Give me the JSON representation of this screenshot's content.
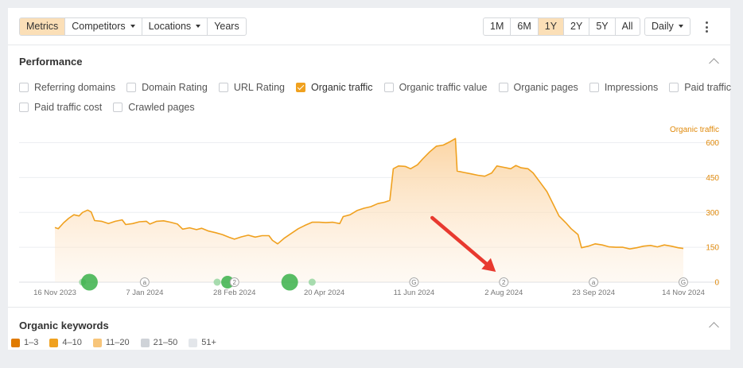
{
  "toolbar": {
    "left_tabs": [
      {
        "label": "Metrics",
        "active": true,
        "dropdown": false
      },
      {
        "label": "Competitors",
        "active": false,
        "dropdown": true
      },
      {
        "label": "Locations",
        "active": false,
        "dropdown": true
      },
      {
        "label": "Years",
        "active": false,
        "dropdown": false
      }
    ],
    "ranges": [
      {
        "label": "1M",
        "active": false
      },
      {
        "label": "6M",
        "active": false
      },
      {
        "label": "1Y",
        "active": true
      },
      {
        "label": "2Y",
        "active": false
      },
      {
        "label": "5Y",
        "active": false
      },
      {
        "label": "All",
        "active": false
      }
    ],
    "interval": "Daily"
  },
  "performance": {
    "title": "Performance",
    "metrics_row1": [
      {
        "label": "Referring domains",
        "checked": false
      },
      {
        "label": "Domain Rating",
        "checked": false
      },
      {
        "label": "URL Rating",
        "checked": false
      },
      {
        "label": "Organic traffic",
        "checked": true
      },
      {
        "label": "Organic traffic value",
        "checked": false
      },
      {
        "label": "Organic pages",
        "checked": false
      },
      {
        "label": "Impressions",
        "checked": false
      },
      {
        "label": "Paid traffic",
        "checked": false
      }
    ],
    "metrics_row2": [
      {
        "label": "Paid traffic cost",
        "checked": false
      },
      {
        "label": "Crawled pages",
        "checked": false
      }
    ]
  },
  "organic_keywords": {
    "title": "Organic keywords",
    "legend": [
      {
        "label": "1–3",
        "color": "#e07b00"
      },
      {
        "label": "4–10",
        "color": "#f0a11f"
      },
      {
        "label": "11–20",
        "color": "#f7c57a"
      },
      {
        "label": "21–50",
        "color": "#cfd3d8"
      },
      {
        "label": "51+",
        "color": "#e3e6ea"
      }
    ]
  },
  "colors": {
    "accent": "#f0a11f",
    "line": "#f0a11f",
    "area_top": "#fbd9ad",
    "marker_green": "#3bb24a",
    "arrow": "#e8392f"
  },
  "chart_data": {
    "type": "area",
    "series_label": "Organic traffic",
    "ylim": [
      0,
      660
    ],
    "y_ticks": [
      "600",
      "450",
      "300",
      "150",
      "0"
    ],
    "y_tick_values": [
      600,
      450,
      300,
      150,
      0
    ],
    "x_ticks": [
      "16 Nov 2023",
      "7 Jan 2024",
      "28 Feb 2024",
      "20 Apr 2024",
      "11 Jun 2024",
      "2 Aug 2024",
      "23 Sep 2024",
      "14 Nov 2024"
    ],
    "x_tick_dates": [
      "2023-11-16",
      "2024-01-07",
      "2024-02-28",
      "2024-04-20",
      "2024-06-11",
      "2024-08-02",
      "2024-09-23",
      "2024-11-14"
    ],
    "series": [
      {
        "name": "Organic traffic",
        "points": [
          [
            "2023-11-16",
            235
          ],
          [
            "2023-11-18",
            230
          ],
          [
            "2023-11-21",
            255
          ],
          [
            "2023-11-24",
            275
          ],
          [
            "2023-11-27",
            290
          ],
          [
            "2023-11-30",
            285
          ],
          [
            "2023-12-02",
            300
          ],
          [
            "2023-12-05",
            310
          ],
          [
            "2023-12-07",
            302
          ],
          [
            "2023-12-09",
            265
          ],
          [
            "2023-12-13",
            262
          ],
          [
            "2023-12-17",
            252
          ],
          [
            "2023-12-21",
            262
          ],
          [
            "2023-12-25",
            268
          ],
          [
            "2023-12-27",
            248
          ],
          [
            "2023-12-31",
            252
          ],
          [
            "2024-01-04",
            260
          ],
          [
            "2024-01-08",
            262
          ],
          [
            "2024-01-10",
            250
          ],
          [
            "2024-01-14",
            262
          ],
          [
            "2024-01-18",
            264
          ],
          [
            "2024-01-22",
            258
          ],
          [
            "2024-01-26",
            250
          ],
          [
            "2024-01-29",
            228
          ],
          [
            "2024-02-02",
            234
          ],
          [
            "2024-02-06",
            226
          ],
          [
            "2024-02-09",
            232
          ],
          [
            "2024-02-13",
            220
          ],
          [
            "2024-02-17",
            213
          ],
          [
            "2024-02-21",
            205
          ],
          [
            "2024-02-25",
            193
          ],
          [
            "2024-02-28",
            185
          ],
          [
            "2024-03-03",
            195
          ],
          [
            "2024-03-07",
            202
          ],
          [
            "2024-03-11",
            194
          ],
          [
            "2024-03-15",
            200
          ],
          [
            "2024-03-19",
            200
          ],
          [
            "2024-03-21",
            180
          ],
          [
            "2024-03-24",
            165
          ],
          [
            "2024-03-28",
            190
          ],
          [
            "2024-04-01",
            210
          ],
          [
            "2024-04-05",
            230
          ],
          [
            "2024-04-09",
            245
          ],
          [
            "2024-04-13",
            258
          ],
          [
            "2024-04-17",
            258
          ],
          [
            "2024-04-21",
            256
          ],
          [
            "2024-04-25",
            258
          ],
          [
            "2024-04-29",
            252
          ],
          [
            "2024-05-01",
            282
          ],
          [
            "2024-05-05",
            290
          ],
          [
            "2024-05-09",
            308
          ],
          [
            "2024-05-13",
            318
          ],
          [
            "2024-05-17",
            325
          ],
          [
            "2024-05-21",
            338
          ],
          [
            "2024-05-25",
            344
          ],
          [
            "2024-05-28",
            352
          ],
          [
            "2024-05-30",
            488
          ],
          [
            "2024-06-02",
            500
          ],
          [
            "2024-06-06",
            498
          ],
          [
            "2024-06-09",
            488
          ],
          [
            "2024-06-13",
            505
          ],
          [
            "2024-06-16",
            530
          ],
          [
            "2024-06-20",
            560
          ],
          [
            "2024-06-24",
            585
          ],
          [
            "2024-06-28",
            590
          ],
          [
            "2024-07-02",
            605
          ],
          [
            "2024-07-05",
            618
          ],
          [
            "2024-07-06",
            478
          ],
          [
            "2024-07-10",
            472
          ],
          [
            "2024-07-14",
            466
          ],
          [
            "2024-07-18",
            460
          ],
          [
            "2024-07-22",
            456
          ],
          [
            "2024-07-26",
            470
          ],
          [
            "2024-07-29",
            500
          ],
          [
            "2024-08-02",
            494
          ],
          [
            "2024-08-06",
            488
          ],
          [
            "2024-08-09",
            502
          ],
          [
            "2024-08-12",
            492
          ],
          [
            "2024-08-16",
            488
          ],
          [
            "2024-08-19",
            470
          ],
          [
            "2024-08-23",
            430
          ],
          [
            "2024-08-27",
            390
          ],
          [
            "2024-08-31",
            330
          ],
          [
            "2024-09-03",
            285
          ],
          [
            "2024-09-07",
            255
          ],
          [
            "2024-09-10",
            230
          ],
          [
            "2024-09-14",
            205
          ],
          [
            "2024-09-16",
            148
          ],
          [
            "2024-09-20",
            155
          ],
          [
            "2024-09-24",
            165
          ],
          [
            "2024-09-28",
            160
          ],
          [
            "2024-10-02",
            152
          ],
          [
            "2024-10-06",
            150
          ],
          [
            "2024-10-10",
            150
          ],
          [
            "2024-10-14",
            143
          ],
          [
            "2024-10-18",
            148
          ],
          [
            "2024-10-22",
            155
          ],
          [
            "2024-10-26",
            158
          ],
          [
            "2024-10-30",
            152
          ],
          [
            "2024-11-03",
            160
          ],
          [
            "2024-11-07",
            155
          ],
          [
            "2024-11-11",
            148
          ],
          [
            "2024-11-14",
            145
          ]
        ]
      }
    ],
    "annotation_markers": [
      {
        "date": "2023-12-02",
        "kind": "dot",
        "size": "small"
      },
      {
        "date": "2023-12-06",
        "kind": "dot",
        "size": "large"
      },
      {
        "date": "2024-01-07",
        "kind": "badge",
        "label": "a"
      },
      {
        "date": "2024-02-18",
        "kind": "dot",
        "size": "small"
      },
      {
        "date": "2024-02-24",
        "kind": "dot",
        "size": "medium"
      },
      {
        "date": "2024-02-28",
        "kind": "badge",
        "label": "2"
      },
      {
        "date": "2024-03-31",
        "kind": "dot",
        "size": "large"
      },
      {
        "date": "2024-04-13",
        "kind": "dot",
        "size": "small"
      },
      {
        "date": "2024-06-11",
        "kind": "badge",
        "label": "G"
      },
      {
        "date": "2024-08-02",
        "kind": "badge",
        "label": "2"
      },
      {
        "date": "2024-09-23",
        "kind": "badge",
        "label": "a"
      },
      {
        "date": "2024-11-14",
        "kind": "badge",
        "label": "G"
      }
    ],
    "callout_arrow_target_date": "2024-08-02",
    "grid": true,
    "legend": "top-right"
  }
}
